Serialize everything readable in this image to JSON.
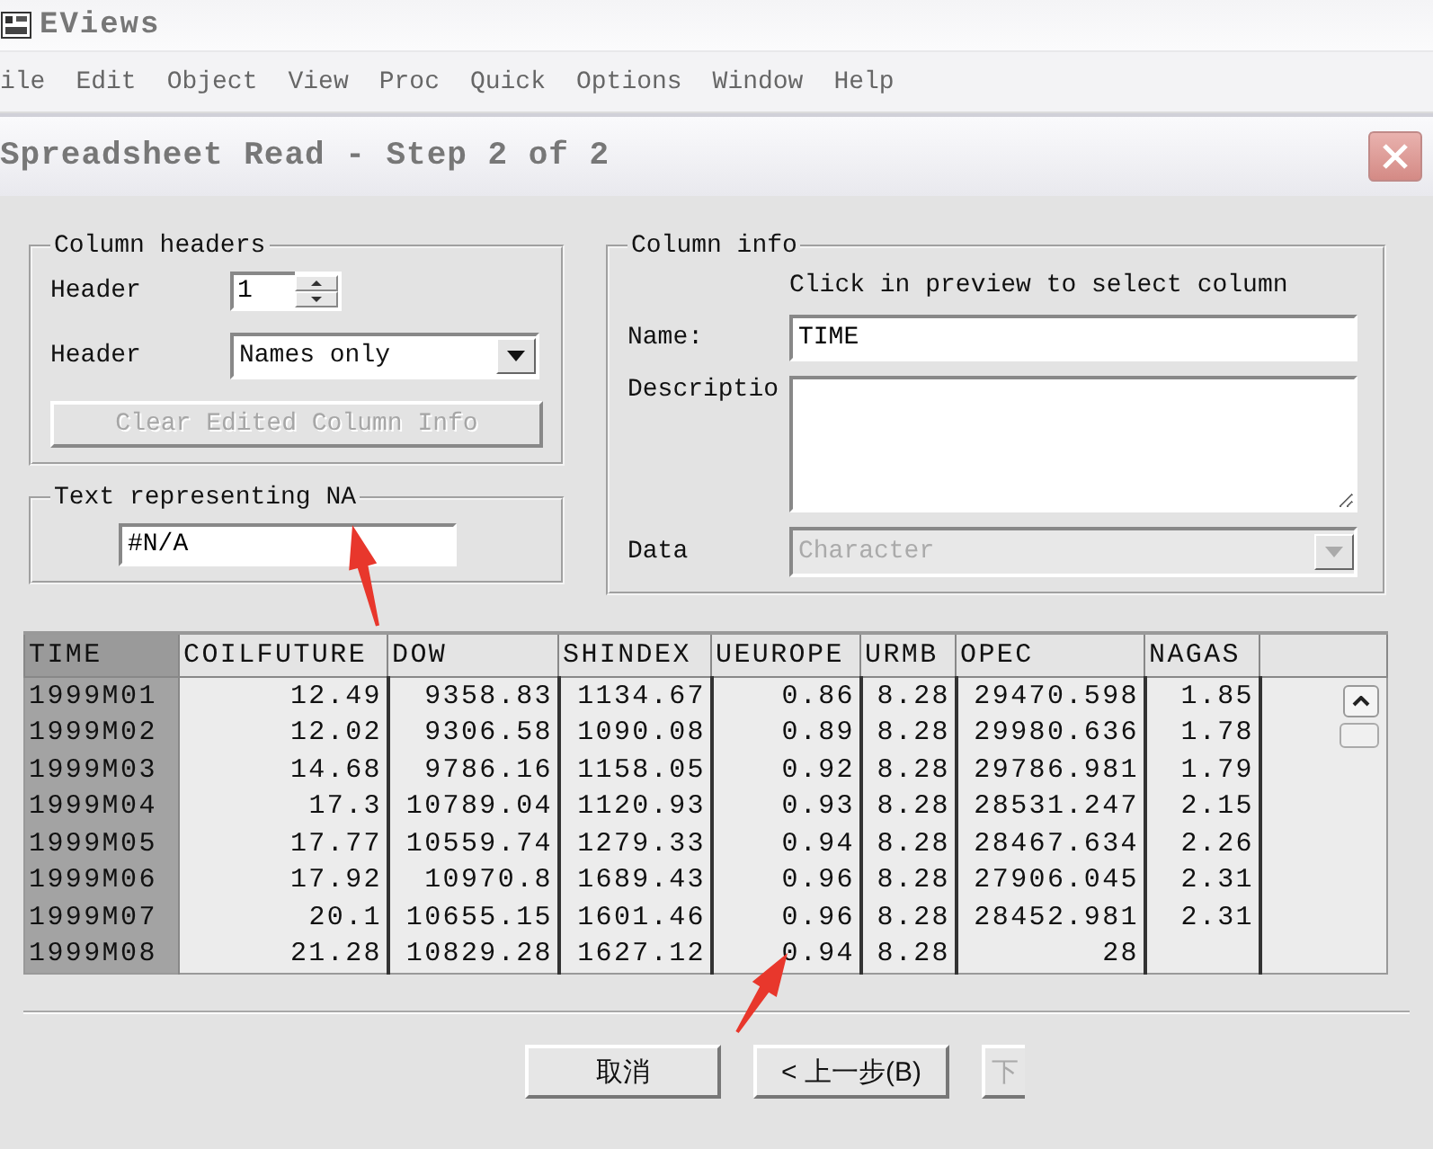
{
  "app": {
    "title": "EViews",
    "menu": [
      "ile",
      "Edit",
      "Object",
      "View",
      "Proc",
      "Quick",
      "Options",
      "Window",
      "Help"
    ]
  },
  "dialog": {
    "title": "Spreadsheet Read - Step 2 of 2",
    "column_headers": {
      "title": "Column headers",
      "header_label": "Header",
      "header_value": "1",
      "header_type_label": "Header",
      "header_type_value": "Names only",
      "clear_button": {
        "label": "Clear Edited Column Info",
        "disabled": true
      }
    },
    "na_group": {
      "title": "Text representing NA",
      "value": "#N/A"
    },
    "column_info": {
      "title": "Column info",
      "hint": "Click in preview to select column",
      "name_label": "Name:",
      "name_value": "TIME",
      "description_label": "Descriptio",
      "data_label": "Data",
      "data_value": "Character",
      "data_disabled": true
    },
    "table": {
      "columns": [
        {
          "label": "TIME",
          "selected": true
        },
        {
          "label": "COILFUTURE",
          "selected": false
        },
        {
          "label": "DOW",
          "selected": false
        },
        {
          "label": "SHINDEX",
          "selected": false
        },
        {
          "label": "UEUROPE",
          "selected": false
        },
        {
          "label": "URMB",
          "selected": false
        },
        {
          "label": "OPEC",
          "selected": false
        },
        {
          "label": "NAGAS",
          "selected": false
        }
      ],
      "rows": [
        [
          "1999M01",
          "12.49",
          "9358.83",
          "1134.67",
          "0.86",
          "8.28",
          "29470.598",
          "1.85"
        ],
        [
          "1999M02",
          "12.02",
          "9306.58",
          "1090.08",
          "0.89",
          "8.28",
          "29980.636",
          "1.78"
        ],
        [
          "1999M03",
          "14.68",
          "9786.16",
          "1158.05",
          "0.92",
          "8.28",
          "29786.981",
          "1.79"
        ],
        [
          "1999M04",
          "17.3",
          "10789.04",
          "1120.93",
          "0.93",
          "8.28",
          "28531.247",
          "2.15"
        ],
        [
          "1999M05",
          "17.77",
          "10559.74",
          "1279.33",
          "0.94",
          "8.28",
          "28467.634",
          "2.26"
        ],
        [
          "1999M06",
          "17.92",
          "10970.8",
          "1689.43",
          "0.96",
          "8.28",
          "27906.045",
          "2.31"
        ],
        [
          "1999M07",
          "20.1",
          "10655.15",
          "1601.46",
          "0.96",
          "8.28",
          "28452.981",
          "2.31"
        ],
        [
          "1999M08",
          "21.28",
          "10829.28",
          "1627.12",
          "0.94",
          "8.28",
          "28"
        ]
      ]
    },
    "buttons": [
      {
        "label": "取消"
      },
      {
        "label": "< 上一步(B)"
      },
      {
        "label": "下"
      }
    ],
    "annotations": [
      {
        "kind": "arrow"
      },
      {
        "kind": "arrow"
      }
    ]
  }
}
